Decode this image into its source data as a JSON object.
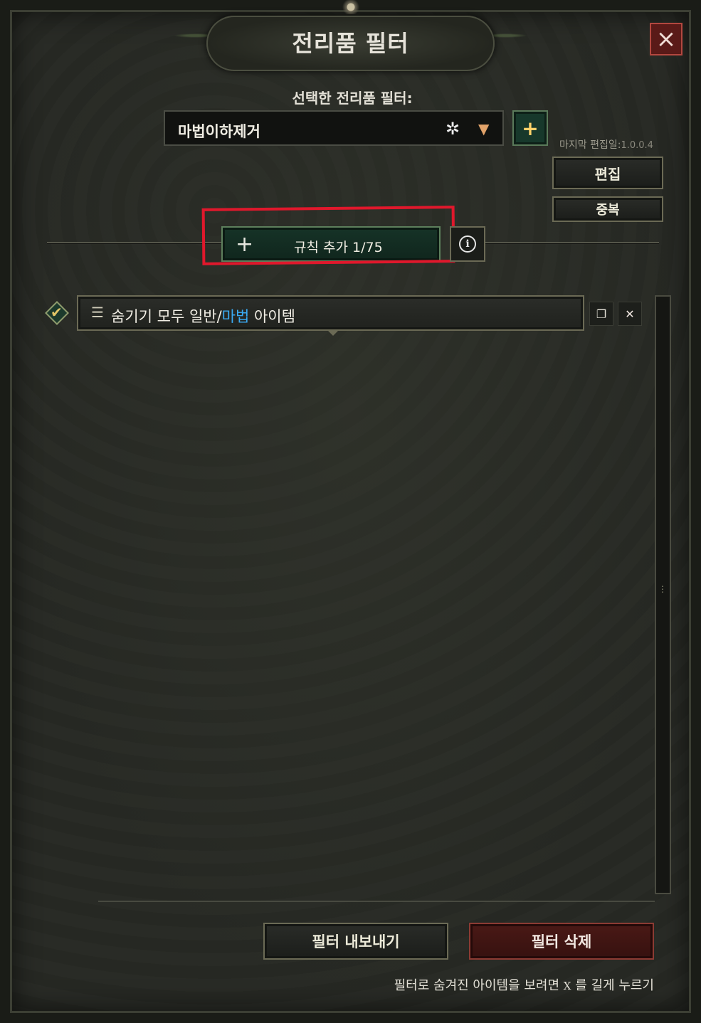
{
  "window": {
    "title": "전리품 필터",
    "close_icon": "×"
  },
  "filter_select": {
    "label": "선택한 전리품 필터:",
    "selected": "마법이하제거",
    "star_icon": "✲",
    "arrow_icon": "▼",
    "add_icon": "+"
  },
  "meta": {
    "last_edit_label": "마지막 편집일:",
    "version": "1.0.0.4"
  },
  "buttons": {
    "edit": "편집",
    "duplicate": "중복",
    "add_rule_plus": "+",
    "add_rule": "규칙 추가 1/75",
    "info": "i",
    "export": "필터 내보내기",
    "delete": "필터 삭제"
  },
  "rules": [
    {
      "enabled": true,
      "check_icon": "✔",
      "grip_icon": "☰",
      "text_prefix": "숨기기 모두 일반/",
      "text_highlight": "마법",
      "text_suffix": " 아이템",
      "copy_icon": "❐",
      "delete_icon": "✕"
    }
  ],
  "scroll_handle_icon": "⋮",
  "hint": {
    "before": "필터로 숨겨진 아이템을 보려면 ",
    "key": "X",
    "after": " 를 길게 누르기"
  },
  "colors": {
    "magic_text": "#3aaaf2",
    "highlight_box": "#e0182c",
    "delete_button": "#4a1916",
    "add_button": "#163327"
  }
}
